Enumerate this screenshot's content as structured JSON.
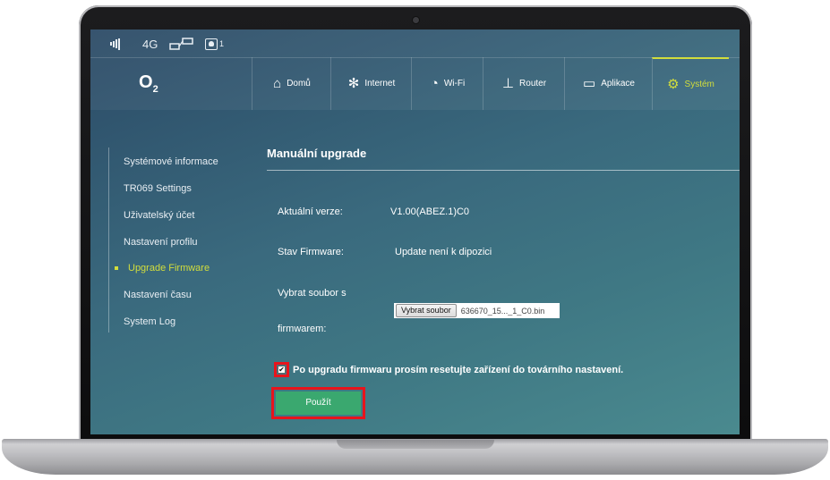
{
  "status_bar": {
    "network": "4G",
    "connected_users": "1",
    "icons": [
      "signal-icon",
      "network-icon",
      "connection-icon",
      "user-icon"
    ]
  },
  "brand": {
    "logo": "O",
    "logo_sub": "2"
  },
  "nav": [
    {
      "label": "Domů",
      "icon": "home-icon",
      "glyph": "⌂"
    },
    {
      "label": "Internet",
      "icon": "globe-icon",
      "glyph": "✻"
    },
    {
      "label": "Wi-Fi",
      "icon": "wifi-icon",
      "glyph": "◔"
    },
    {
      "label": "Router",
      "icon": "router-icon",
      "glyph": "⊥"
    },
    {
      "label": "Aplikace",
      "icon": "monitor-icon",
      "glyph": "▭"
    },
    {
      "label": "Systém",
      "icon": "gear-icon",
      "glyph": "⚙",
      "active": true
    }
  ],
  "sidebar": {
    "items": [
      {
        "label": "Systémové informace"
      },
      {
        "label": "TR069 Settings"
      },
      {
        "label": "Uživatelský účet"
      },
      {
        "label": "Nastavení profilu"
      },
      {
        "label": "Upgrade Firmware",
        "active": true
      },
      {
        "label": "Nastavení času"
      },
      {
        "label": "System Log"
      }
    ]
  },
  "main": {
    "title": "Manuální upgrade",
    "current_version_label": "Aktuální verze:",
    "current_version_value": "V1.00(ABEZ.1)C0",
    "firmware_status_label": "Stav Firmware:",
    "firmware_status_value": "Update není k dipozici",
    "file_label_line1": "Vybrat soubor s",
    "file_label_line2": "firmwarem:",
    "file_button": "Vybrat soubor",
    "file_name": "636670_15..._1_C0.bin",
    "reset_checkbox_checked": true,
    "reset_checkbox_label": "Po upgradu firmwaru prosím resetujte zařízení do továrního nastavení.",
    "apply_button": "Použít"
  },
  "colors": {
    "accent": "#d2dd3c",
    "apply": "#3aa86f",
    "highlight": "#e8141c"
  }
}
